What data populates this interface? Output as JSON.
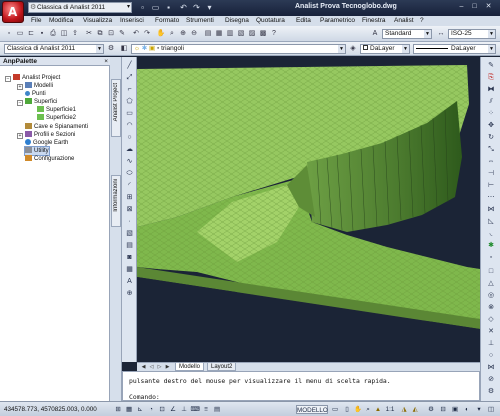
{
  "app": {
    "workspace": "Classica di Analist 2011",
    "title_app": "Analist",
    "title_file": "Prova Tecnoglobo.dwg"
  },
  "menu": [
    "File",
    "Modifica",
    "Visualizza",
    "Inserisci",
    "Formato",
    "Strumenti",
    "Disegna",
    "Quotatura",
    "Edita",
    "Parametrico",
    "Finestra",
    "Analist",
    "?"
  ],
  "toolbar": {
    "text_style": "Standard",
    "dim_style": "ISO-25"
  },
  "layers": {
    "workspace": "Classica di Analist 2011",
    "layer": "triangoli",
    "color": "DaLayer",
    "linetype": "DaLayer"
  },
  "palette": {
    "title": "AnpPalette",
    "close": "×",
    "items": [
      {
        "label": "Analist Project"
      },
      {
        "label": "Modelli"
      },
      {
        "label": "Punti"
      },
      {
        "label": "Superfici"
      },
      {
        "label": "Superficie1"
      },
      {
        "label": "Superficie2"
      },
      {
        "label": "Cave e Spianamenti"
      },
      {
        "label": "Profili e Sezioni"
      },
      {
        "label": "Google Earth"
      },
      {
        "label": "Utility"
      },
      {
        "label": "Configurazione"
      }
    ]
  },
  "vtabs": {
    "project": "Analist Project",
    "info": "Informazioni"
  },
  "layout_tabs": [
    "Modello",
    "Layout2"
  ],
  "command": {
    "line1": "pulsante destro del mouse per visualizzare il menu di scelta rapida.",
    "prompt": "Comando:"
  },
  "status": {
    "coords": "434578.773, 4570825.003, 0.000",
    "mode": "MODELLO",
    "scale": "1:1"
  },
  "colors": {
    "terrain": "#8bc34a",
    "background": "#1b2436"
  }
}
